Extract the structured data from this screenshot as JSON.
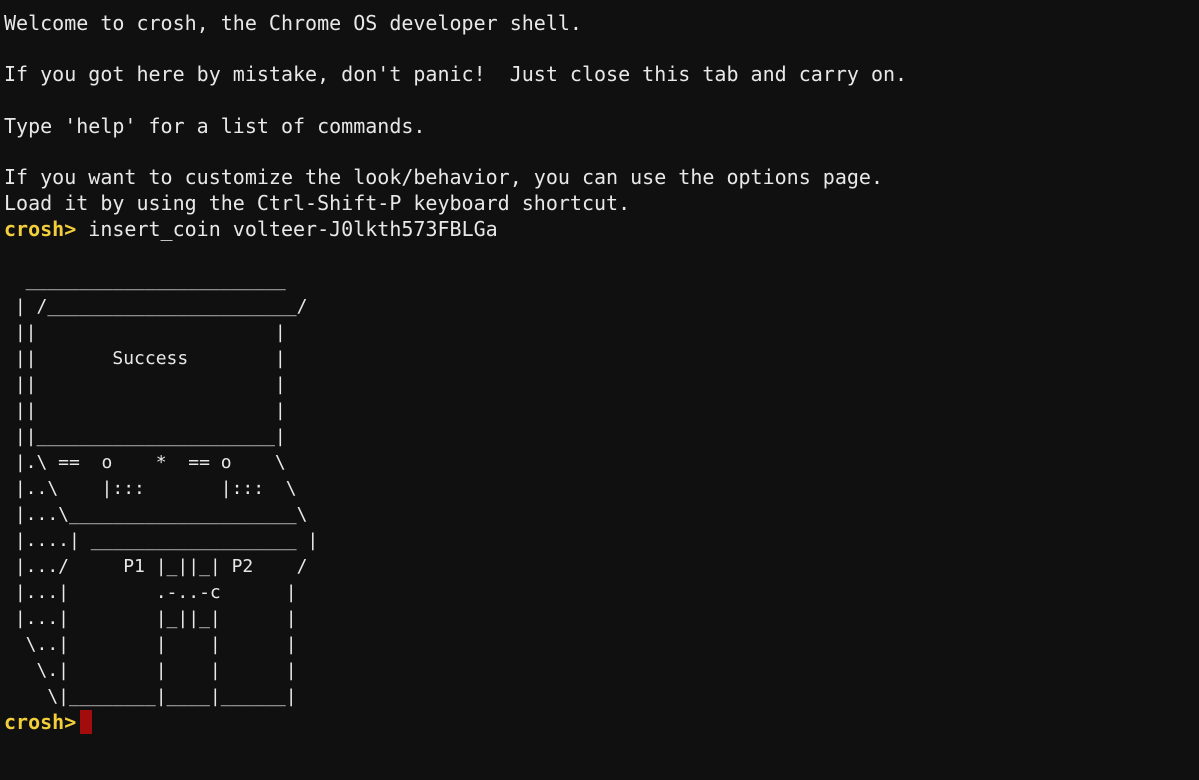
{
  "terminal": {
    "intro_lines": [
      "Welcome to crosh, the Chrome OS developer shell.",
      "",
      "If you got here by mistake, don't panic!  Just close this tab and carry on.",
      "",
      "Type 'help' for a list of commands.",
      "",
      "If you want to customize the look/behavior, you can use the options page.",
      "Load it by using the Ctrl-Shift-P keyboard shortcut."
    ],
    "prompt": "crosh>",
    "command": "insert_coin volteer-J0lkth573FBLGa",
    "art_lines": [
      "  ________________________",
      " | /_______________________/",
      " ||                      |",
      " ||       Success        |",
      " ||                      |",
      " ||                      |",
      " ||______________________|",
      " |.\\ ==  o    *  == o    \\",
      " |..\\    |:::       |:::  \\",
      " |...\\_____________________\\",
      " |....| ___________________ |",
      " |.../     P1 |_||_| P2    /",
      " |...|        .-..-c      |",
      " |...|        |_||_|      |",
      "  \\..|        |    |      |",
      "   \\.|        |    |      |",
      "    \\|________|____|______|"
    ],
    "final_prompt": "crosh>",
    "cursor_color": "#a20c0c",
    "prompt_color": "#f2cf3a",
    "background_color": "#101010",
    "text_color": "#e8e8e8"
  }
}
